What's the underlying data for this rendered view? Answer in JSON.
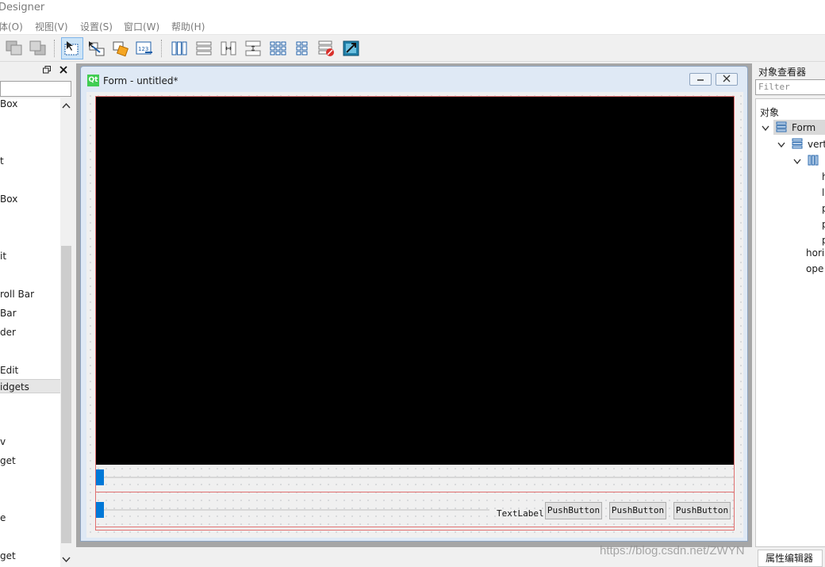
{
  "app": {
    "title": "Designer"
  },
  "menu": [
    "体(O)",
    "视图(V)",
    "设置(S)",
    "窗口(W)",
    "帮助(H)"
  ],
  "widget_box": {
    "items": [
      {
        "label": "Box"
      },
      {
        "label": "t"
      },
      {
        "label": "Box"
      },
      {
        "label": "it"
      },
      {
        "label": "roll Bar"
      },
      {
        "label": " Bar"
      },
      {
        "label": "der"
      },
      {
        "label": " Edit"
      },
      {
        "label": "idgets",
        "category": true
      },
      {
        "label": "v"
      },
      {
        "label": "get"
      },
      {
        "label": "e"
      },
      {
        "label": "get"
      }
    ]
  },
  "form": {
    "title": "Form - untitled*",
    "text_label": "TextLabel",
    "buttons": [
      "PushButton",
      "PushButton",
      "PushButton"
    ]
  },
  "object_inspector": {
    "title": "对象查看器",
    "filter_placeholder": "Filter",
    "column_header": "对象",
    "tree": [
      "Form",
      "vert",
      "h",
      "l",
      "p",
      "p",
      "p",
      "hori",
      "ope"
    ],
    "bottom_tab": "属性编辑器"
  },
  "watermark": "https://blog.csdn.net/ZWYN"
}
